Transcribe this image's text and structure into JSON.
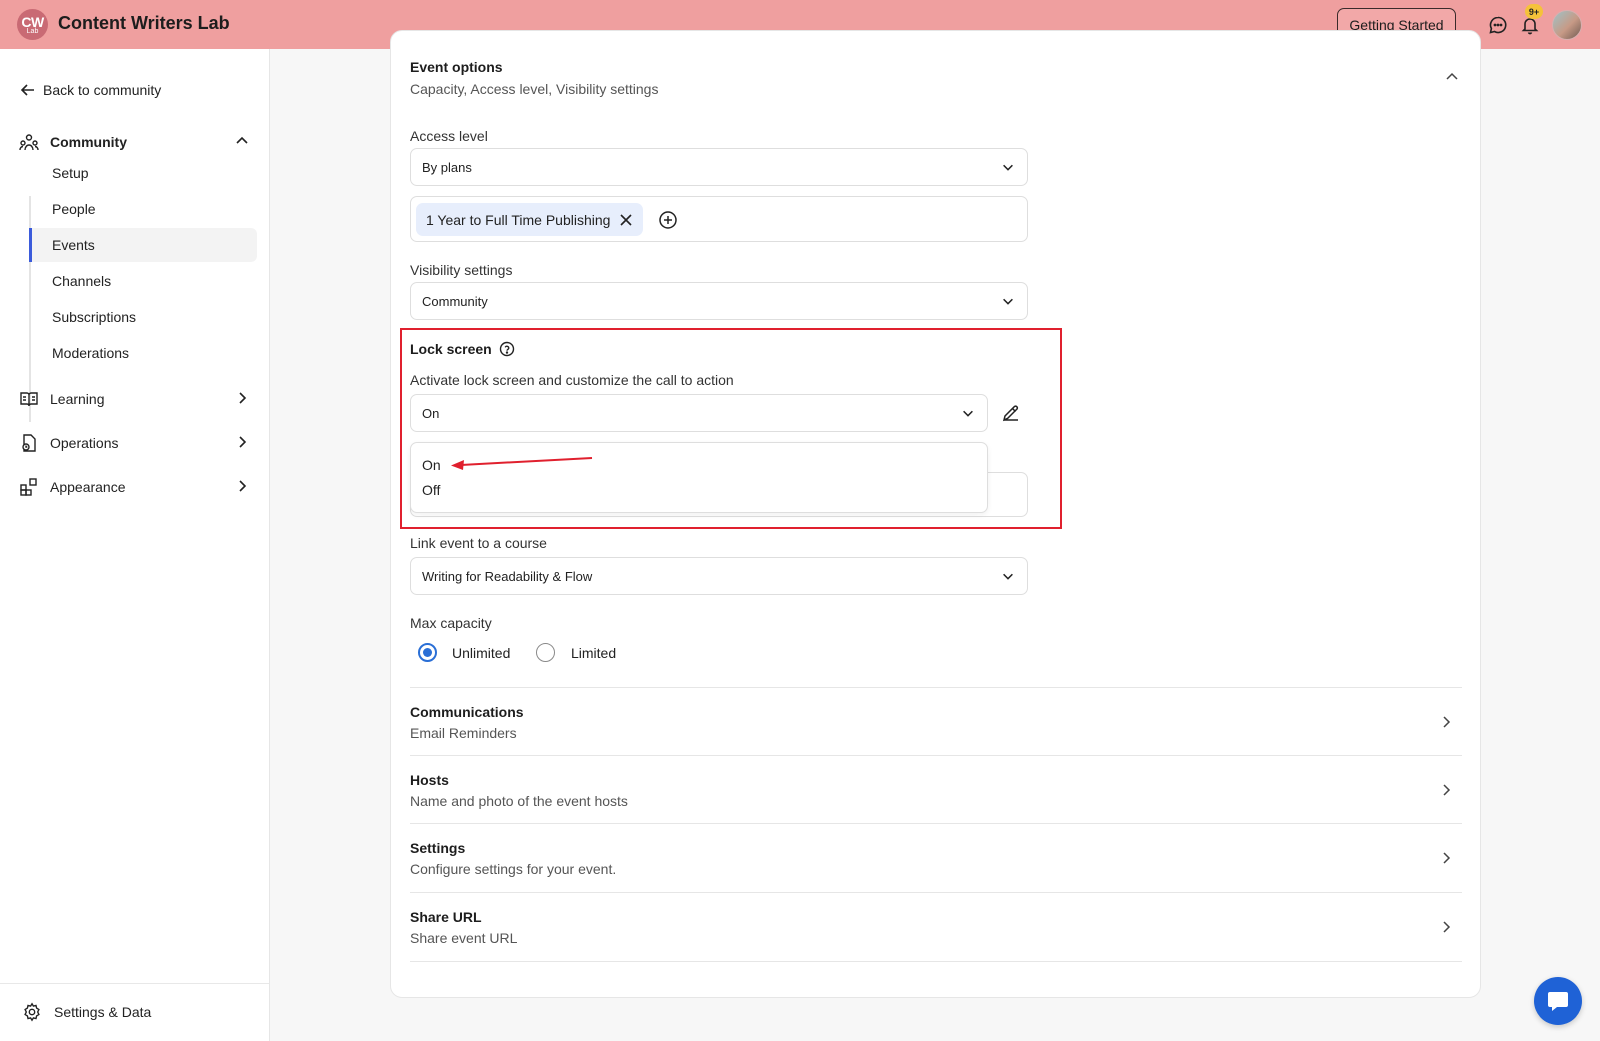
{
  "header": {
    "logo_main": "CW",
    "logo_sub": "Lab",
    "title": "Content Writers Lab",
    "getting_started": "Getting Started",
    "notifications_badge": "9+"
  },
  "sidebar": {
    "back_label": "Back to community",
    "community": {
      "label": "Community",
      "items": [
        "Setup",
        "People",
        "Events",
        "Channels",
        "Subscriptions",
        "Moderations"
      ],
      "active": "Events"
    },
    "sections": [
      "Learning",
      "Operations",
      "Appearance"
    ],
    "settings_label": "Settings & Data"
  },
  "event_options": {
    "title": "Event options",
    "subtitle": "Capacity, Access level, Visibility settings",
    "access_level": {
      "label": "Access level",
      "value": "By plans",
      "tags": [
        "1 Year to Full Time Publishing"
      ]
    },
    "visibility": {
      "label": "Visibility settings",
      "value": "Community"
    },
    "lock_screen": {
      "title": "Lock screen",
      "description": "Activate lock screen and customize the call to action",
      "value": "On",
      "options": [
        "On",
        "Off"
      ]
    },
    "link_course": {
      "label": "Link event to a course",
      "value": "Writing for Readability & Flow"
    },
    "max_capacity": {
      "label": "Max capacity",
      "options": [
        "Unlimited",
        "Limited"
      ],
      "selected": "Unlimited"
    }
  },
  "collapsed_sections": [
    {
      "title": "Communications",
      "subtitle": "Email Reminders"
    },
    {
      "title": "Hosts",
      "subtitle": "Name and photo of the event hosts"
    },
    {
      "title": "Settings",
      "subtitle": "Configure settings for your event."
    },
    {
      "title": "Share URL",
      "subtitle": "Share event URL"
    }
  ],
  "colors": {
    "topbar": "#ef9f9f",
    "accent": "#3b5bdb",
    "highlight": "#e0202e",
    "radio": "#2a6fd6",
    "chat_button": "#1f62d6"
  }
}
